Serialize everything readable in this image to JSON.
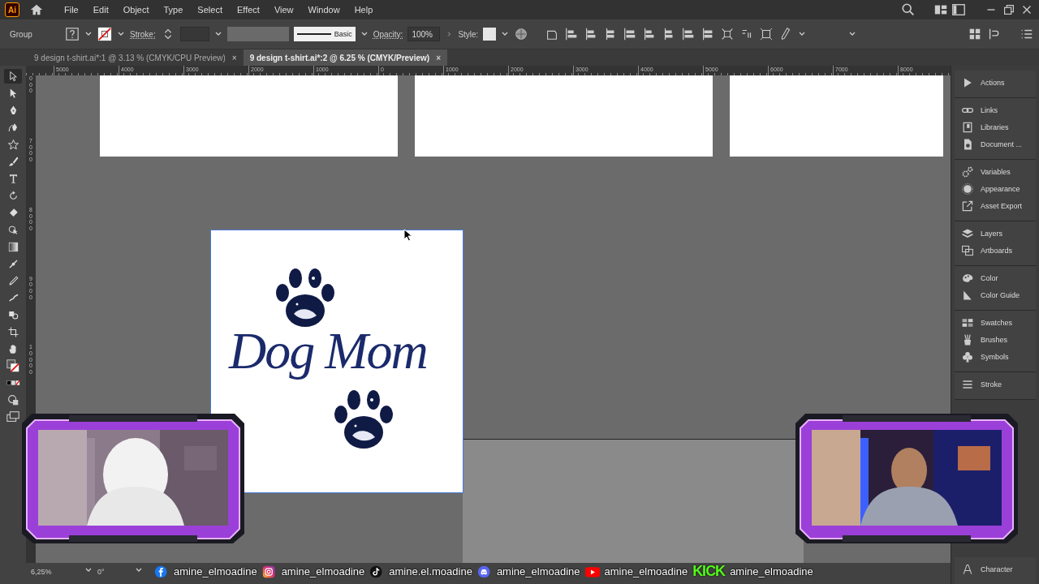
{
  "app": {
    "logo": "Ai"
  },
  "menu": [
    "File",
    "Edit",
    "Object",
    "Type",
    "Select",
    "Effect",
    "View",
    "Window",
    "Help"
  ],
  "control_bar": {
    "selection": "Group",
    "stroke_label": "Stroke:",
    "brush": "Basic",
    "opacity_label": "Opacity:",
    "opacity": "100%",
    "style_label": "Style:"
  },
  "tabs": [
    {
      "label": "9 design t-shirt.ai*:1 @ 3.13 % (CMYK/CPU Preview)",
      "close": "×",
      "selected": false
    },
    {
      "label": "9 design t-shirt.ai*:2 @ 6.25 % (CMYK/Preview)",
      "close": "×",
      "selected": true
    }
  ],
  "ruler_h": [
    "5000",
    "4000",
    "3000",
    "2000",
    "1000",
    "0",
    "1000",
    "2000",
    "3000",
    "4000",
    "5000",
    "6000",
    "7000",
    "8000"
  ],
  "ruler_v": [
    "000",
    "7000",
    "8000",
    "9000",
    "10000"
  ],
  "tools": [
    {
      "kind": "selection",
      "selected": true
    },
    {
      "kind": "direct",
      "selected": false
    },
    {
      "kind": "pen",
      "selected": false
    },
    {
      "kind": "curvature",
      "selected": false
    },
    {
      "kind": "star",
      "selected": false
    },
    {
      "kind": "brush",
      "selected": false
    },
    {
      "kind": "type",
      "selected": false
    },
    {
      "kind": "rotate",
      "selected": false
    },
    {
      "kind": "eraser",
      "selected": false
    },
    {
      "kind": "shapebuilder",
      "selected": false
    },
    {
      "kind": "gradient",
      "selected": false
    },
    {
      "kind": "width",
      "selected": false
    },
    {
      "kind": "eyedropper",
      "selected": false
    },
    {
      "kind": "puppet",
      "selected": false
    },
    {
      "kind": "blend",
      "selected": false
    },
    {
      "kind": "artboard",
      "selected": false
    },
    {
      "kind": "hand",
      "selected": false
    }
  ],
  "artwork": {
    "title": "Dog Mom"
  },
  "panels": [
    [
      {
        "kind": "play",
        "label": "Actions"
      }
    ],
    [
      {
        "kind": "link",
        "label": "Links"
      },
      {
        "kind": "book",
        "label": "Libraries"
      },
      {
        "kind": "info",
        "label": "Document ..."
      }
    ],
    [
      {
        "kind": "gears",
        "label": "Variables"
      },
      {
        "kind": "sun",
        "label": "Appearance"
      },
      {
        "kind": "export",
        "label": "Asset Export"
      }
    ],
    [
      {
        "kind": "layers",
        "label": "Layers"
      },
      {
        "kind": "artboards",
        "label": "Artboards"
      }
    ],
    [
      {
        "kind": "palette",
        "label": "Color"
      },
      {
        "kind": "guide",
        "label": "Color Guide"
      }
    ],
    [
      {
        "kind": "grid",
        "label": "Swatches"
      },
      {
        "kind": "brushes",
        "label": "Brushes"
      },
      {
        "kind": "club",
        "label": "Symbols"
      }
    ],
    [
      {
        "kind": "lines",
        "label": "Stroke"
      }
    ]
  ],
  "panel_bottom": {
    "kind": "char",
    "label": "Character"
  },
  "status": {
    "zoom": "6,25%",
    "rotation": "0°"
  },
  "social": [
    {
      "kind": "facebook",
      "handle": "amine_elmoadine"
    },
    {
      "kind": "instagram",
      "handle": "amine_elmoadine"
    },
    {
      "kind": "tiktok",
      "handle": "amine.el.moadine"
    },
    {
      "kind": "discord",
      "handle": "amine_elmoadine"
    },
    {
      "kind": "youtube",
      "handle": "amine_elmoadine"
    },
    {
      "kind": "kick",
      "logo": "KICK",
      "handle": "amine_elmoadine"
    }
  ],
  "webcams": [
    {
      "kind": "picture"
    },
    {
      "kind": "picture"
    }
  ]
}
